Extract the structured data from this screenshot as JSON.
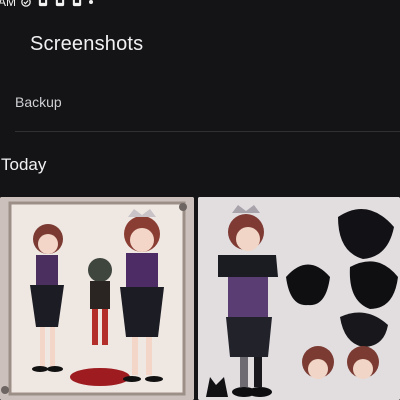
{
  "status_bar": {
    "time": "AM",
    "icons": [
      "check-circle-icon",
      "notification-icon",
      "notification-icon",
      "notification-icon",
      "more-dot-icon"
    ]
  },
  "header": {
    "title": "Screenshots"
  },
  "backup": {
    "label": "Backup"
  },
  "section": {
    "heading": "Today"
  },
  "thumbnails": [
    {
      "name": "screenshot-thumbnail-1"
    },
    {
      "name": "screenshot-thumbnail-2"
    }
  ],
  "colors": {
    "background": "#141416",
    "divider": "#2f3034",
    "text_primary": "#f1f1f3",
    "text_secondary": "#cfd0d4"
  }
}
